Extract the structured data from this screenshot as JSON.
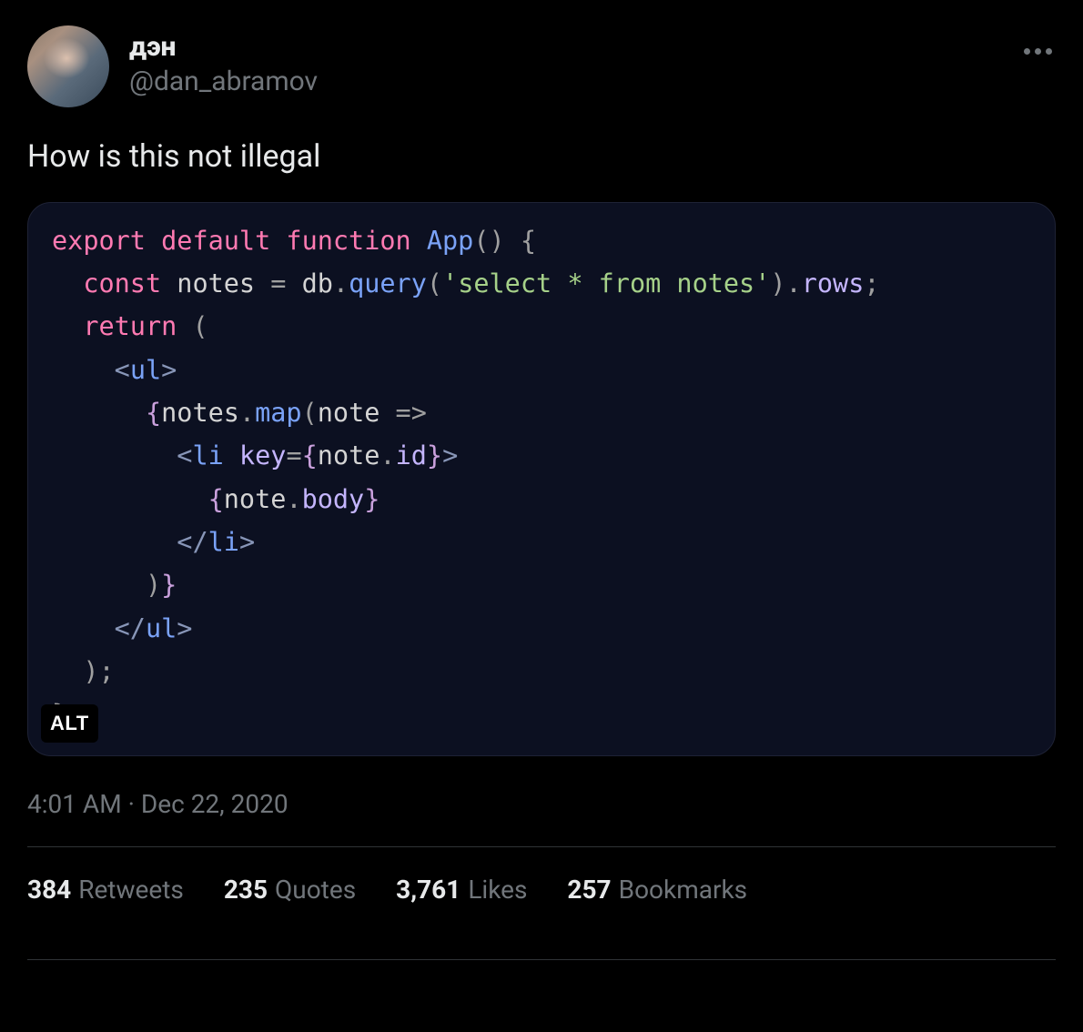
{
  "author": {
    "display_name": "дэн",
    "handle": "@dan_abramov"
  },
  "tweet_text": "How is this not illegal",
  "code": {
    "tokens": [
      [
        {
          "t": "export",
          "c": "tk-kw"
        },
        {
          "t": " ",
          "c": "tk-punc"
        },
        {
          "t": "default",
          "c": "tk-kw"
        },
        {
          "t": " ",
          "c": "tk-punc"
        },
        {
          "t": "function",
          "c": "tk-kw"
        },
        {
          "t": " ",
          "c": "tk-punc"
        },
        {
          "t": "App",
          "c": "tk-fn"
        },
        {
          "t": "()",
          "c": "tk-punc"
        },
        {
          "t": " {",
          "c": "tk-punc"
        }
      ],
      [
        {
          "t": "  ",
          "c": "tk-punc"
        },
        {
          "t": "const",
          "c": "tk-kw"
        },
        {
          "t": " ",
          "c": "tk-punc"
        },
        {
          "t": "notes",
          "c": "tk-var"
        },
        {
          "t": " = ",
          "c": "tk-punc"
        },
        {
          "t": "db",
          "c": "tk-var"
        },
        {
          "t": ".",
          "c": "tk-punc"
        },
        {
          "t": "query",
          "c": "tk-fn"
        },
        {
          "t": "(",
          "c": "tk-punc"
        },
        {
          "t": "'select * from notes'",
          "c": "tk-str"
        },
        {
          "t": ")",
          "c": "tk-punc"
        },
        {
          "t": ".",
          "c": "tk-punc"
        },
        {
          "t": "rows",
          "c": "tk-prop"
        },
        {
          "t": ";",
          "c": "tk-punc"
        }
      ],
      [
        {
          "t": "  ",
          "c": "tk-punc"
        },
        {
          "t": "return",
          "c": "tk-kw"
        },
        {
          "t": " (",
          "c": "tk-punc"
        }
      ],
      [
        {
          "t": "    ",
          "c": "tk-punc"
        },
        {
          "t": "<",
          "c": "tk-angle"
        },
        {
          "t": "ul",
          "c": "tk-tag"
        },
        {
          "t": ">",
          "c": "tk-angle"
        }
      ],
      [
        {
          "t": "      ",
          "c": "tk-punc"
        },
        {
          "t": "{",
          "c": "tk-punc2"
        },
        {
          "t": "notes",
          "c": "tk-var"
        },
        {
          "t": ".",
          "c": "tk-punc"
        },
        {
          "t": "map",
          "c": "tk-fn"
        },
        {
          "t": "(",
          "c": "tk-punc"
        },
        {
          "t": "note",
          "c": "tk-var"
        },
        {
          "t": " => ",
          "c": "tk-punc"
        }
      ],
      [
        {
          "t": "        ",
          "c": "tk-punc"
        },
        {
          "t": "<",
          "c": "tk-angle"
        },
        {
          "t": "li",
          "c": "tk-tag"
        },
        {
          "t": " ",
          "c": "tk-punc"
        },
        {
          "t": "key",
          "c": "tk-prop"
        },
        {
          "t": "=",
          "c": "tk-punc"
        },
        {
          "t": "{",
          "c": "tk-punc2"
        },
        {
          "t": "note",
          "c": "tk-var"
        },
        {
          "t": ".",
          "c": "tk-punc"
        },
        {
          "t": "id",
          "c": "tk-prop"
        },
        {
          "t": "}",
          "c": "tk-punc2"
        },
        {
          "t": ">",
          "c": "tk-angle"
        }
      ],
      [
        {
          "t": "          ",
          "c": "tk-punc"
        },
        {
          "t": "{",
          "c": "tk-punc2"
        },
        {
          "t": "note",
          "c": "tk-var"
        },
        {
          "t": ".",
          "c": "tk-punc"
        },
        {
          "t": "body",
          "c": "tk-prop"
        },
        {
          "t": "}",
          "c": "tk-punc2"
        }
      ],
      [
        {
          "t": "        ",
          "c": "tk-punc"
        },
        {
          "t": "</",
          "c": "tk-angle"
        },
        {
          "t": "li",
          "c": "tk-tag"
        },
        {
          "t": ">",
          "c": "tk-angle"
        }
      ],
      [
        {
          "t": "      ",
          "c": "tk-punc"
        },
        {
          "t": ")",
          "c": "tk-punc"
        },
        {
          "t": "}",
          "c": "tk-punc2"
        }
      ],
      [
        {
          "t": "    ",
          "c": "tk-punc"
        },
        {
          "t": "</",
          "c": "tk-angle"
        },
        {
          "t": "ul",
          "c": "tk-tag"
        },
        {
          "t": ">",
          "c": "tk-angle"
        }
      ],
      [
        {
          "t": "  ",
          "c": "tk-punc"
        },
        {
          "t": ");",
          "c": "tk-punc"
        }
      ],
      [
        {
          "t": "}",
          "c": "tk-punc"
        }
      ]
    ],
    "alt_badge": "ALT"
  },
  "timestamp": {
    "time": "4:01 AM",
    "sep": " · ",
    "date": "Dec 22, 2020"
  },
  "stats": {
    "retweets": {
      "count": "384",
      "label": "Retweets"
    },
    "quotes": {
      "count": "235",
      "label": "Quotes"
    },
    "likes": {
      "count": "3,761",
      "label": "Likes"
    },
    "bookmarks": {
      "count": "257",
      "label": "Bookmarks"
    }
  }
}
